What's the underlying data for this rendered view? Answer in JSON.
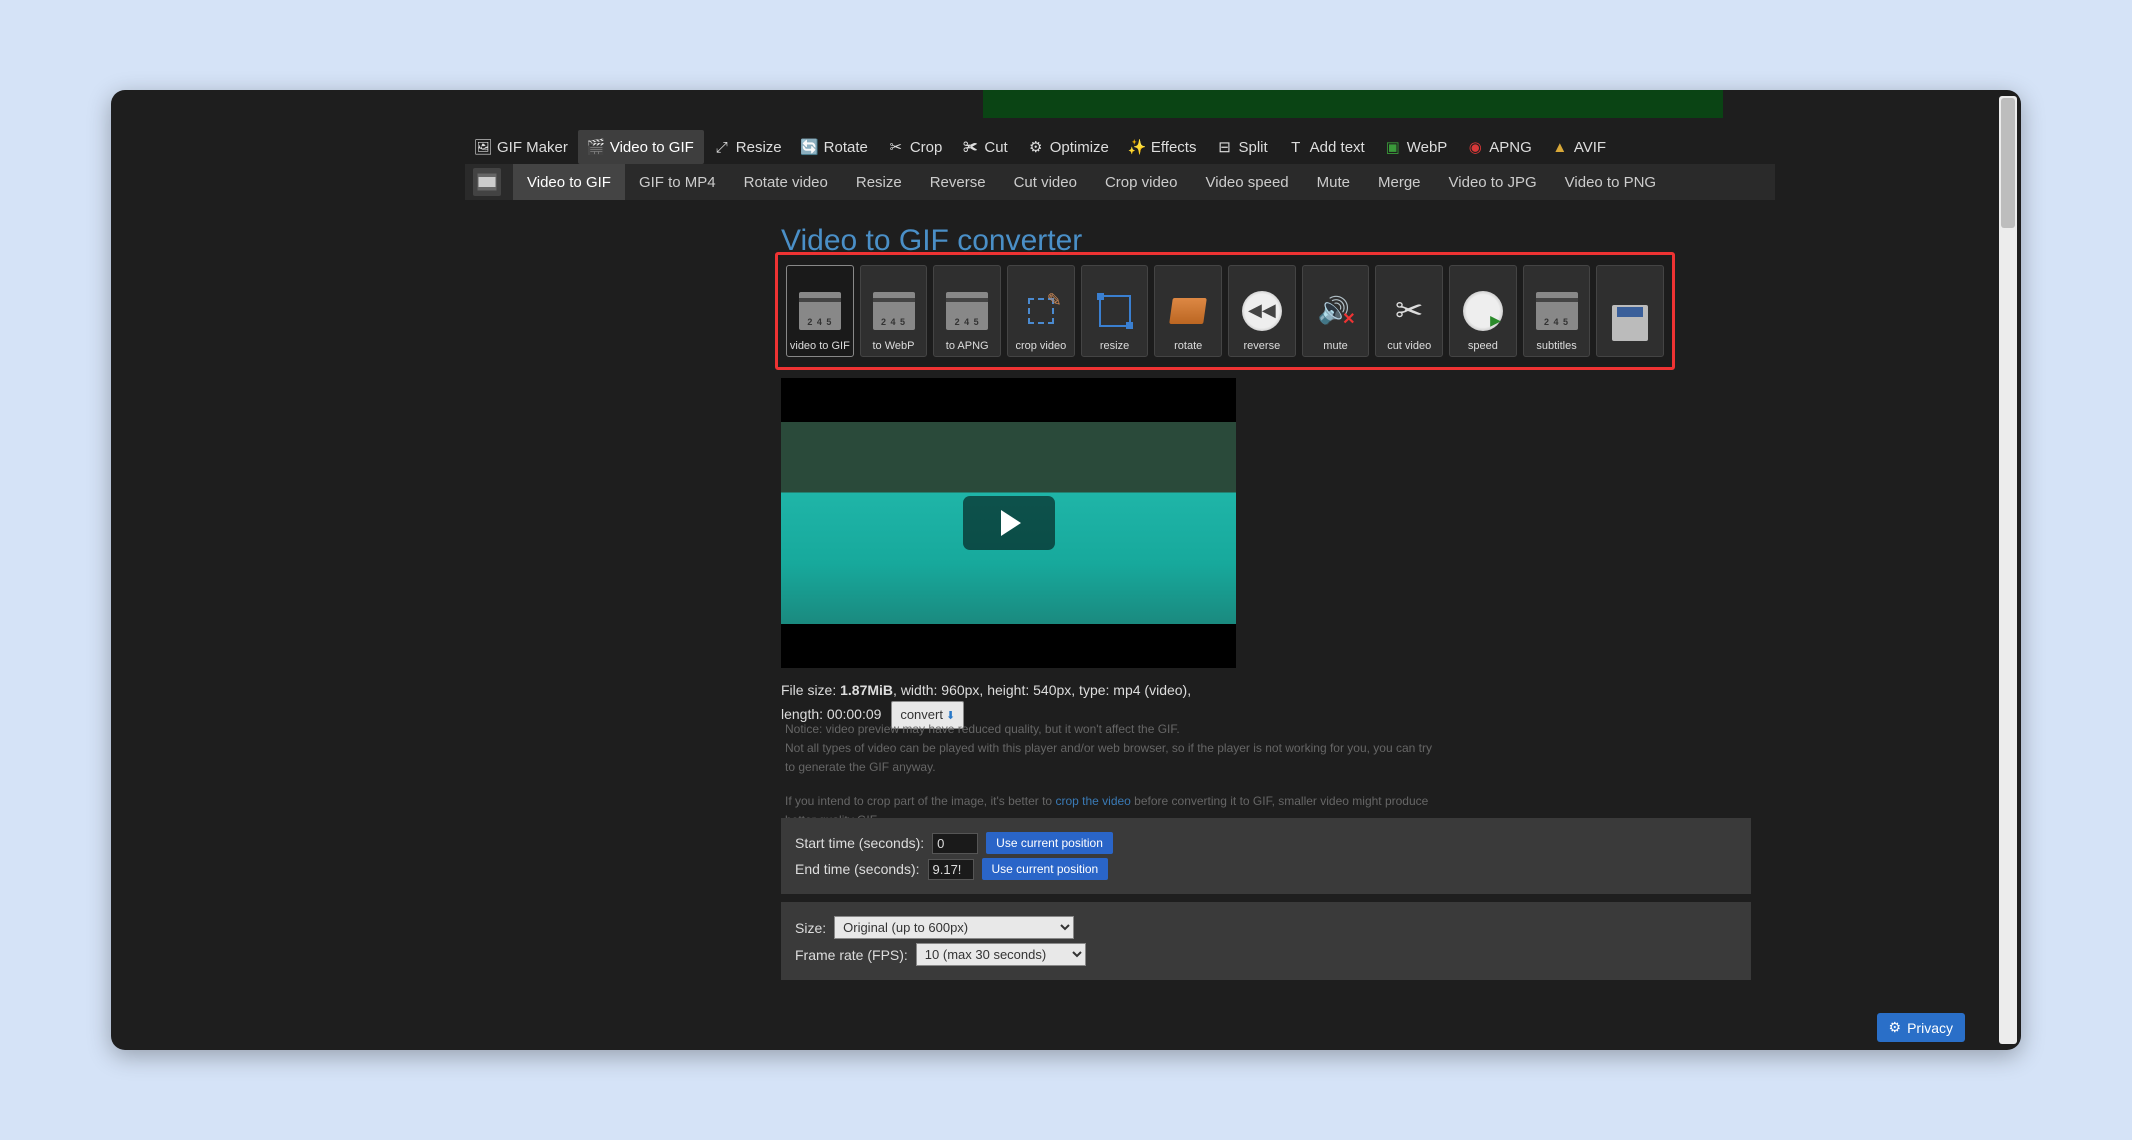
{
  "nav_primary": [
    {
      "label": "GIF Maker",
      "icon": "gif-maker-icon"
    },
    {
      "label": "Video to GIF",
      "icon": "video-to-gif-icon",
      "active": true
    },
    {
      "label": "Resize",
      "icon": "resize-icon"
    },
    {
      "label": "Rotate",
      "icon": "rotate-icon"
    },
    {
      "label": "Crop",
      "icon": "crop-icon"
    },
    {
      "label": "Cut",
      "icon": "cut-icon"
    },
    {
      "label": "Optimize",
      "icon": "optimize-icon"
    },
    {
      "label": "Effects",
      "icon": "effects-icon"
    },
    {
      "label": "Split",
      "icon": "split-icon"
    },
    {
      "label": "Add text",
      "icon": "add-text-icon"
    },
    {
      "label": "WebP",
      "icon": "webp-icon"
    },
    {
      "label": "APNG",
      "icon": "apng-icon"
    },
    {
      "label": "AVIF",
      "icon": "avif-icon"
    }
  ],
  "nav_secondary": [
    "Video to GIF",
    "GIF to MP4",
    "Rotate video",
    "Resize",
    "Reverse",
    "Cut video",
    "Crop video",
    "Video speed",
    "Mute",
    "Merge",
    "Video to JPG",
    "Video to PNG"
  ],
  "nav_secondary_active": 0,
  "page_title": "Video to GIF converter",
  "tools": [
    {
      "label": "video to GIF",
      "active": true
    },
    {
      "label": "to WebP"
    },
    {
      "label": "to APNG"
    },
    {
      "label": "crop video"
    },
    {
      "label": "resize"
    },
    {
      "label": "rotate"
    },
    {
      "label": "reverse"
    },
    {
      "label": "mute"
    },
    {
      "label": "cut video"
    },
    {
      "label": "speed"
    },
    {
      "label": "subtitles"
    },
    {
      "label": "",
      "save": true
    }
  ],
  "file_info": {
    "prefix": "File size: ",
    "size": "1.87MiB",
    "rest": ", width: 960px, height: 540px, type: mp4 (video), length: 00:00:09",
    "convert_label": "convert"
  },
  "notice": {
    "l1": "Notice: video preview may have reduced quality, but it won't affect the GIF.",
    "l2": "Not all types of video can be played with this player and/or web browser, so if the player is not working for you, you can try to generate the GIF anyway.",
    "l3a": "If you intend to crop part of the image, it's better to ",
    "l3link": "crop the video",
    "l3b": " before converting it to GIF, smaller video might produce better quality GIF."
  },
  "form": {
    "start_label": "Start time (seconds):",
    "start_value": "0",
    "end_label": "End time (seconds):",
    "end_value": "9.17!",
    "use_current": "Use current position",
    "size_label": "Size:",
    "size_value": "Original (up to 600px)",
    "fps_label": "Frame rate (FPS):",
    "fps_value": "10 (max 30 seconds)"
  },
  "privacy_label": "Privacy"
}
